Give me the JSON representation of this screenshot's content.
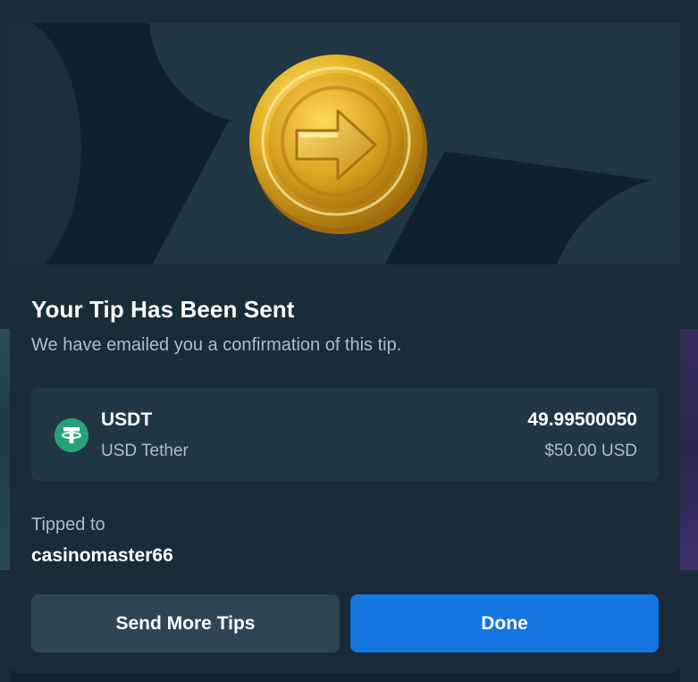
{
  "modal": {
    "title": "Your Tip Has Been Sent",
    "subtitle": "We have emailed you a confirmation of this tip.",
    "currency": {
      "icon": "tether-icon",
      "code": "USDT",
      "name": "USD Tether",
      "amount_crypto": "49.99500050",
      "amount_fiat": "$50.00 USD",
      "color": "#26a17b"
    },
    "tipped_to_label": "Tipped to",
    "tipped_to_user": "casinomaster66",
    "buttons": {
      "send_more": "Send More Tips",
      "done": "Done"
    },
    "colors": {
      "primary": "#1475e1",
      "secondary": "#2f4553",
      "background": "#1a2c38"
    }
  }
}
